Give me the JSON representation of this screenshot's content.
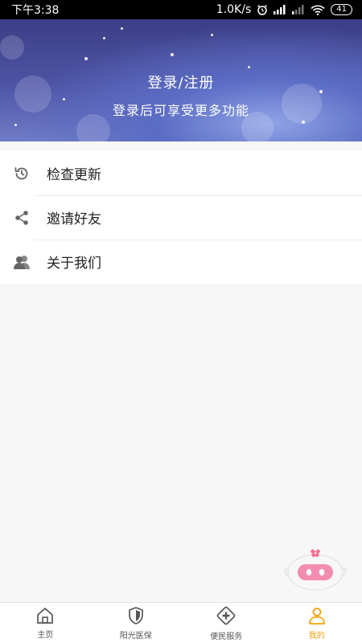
{
  "status_bar": {
    "time": "下午3:38",
    "network_speed": "1.0K/s",
    "battery": "41",
    "icons": [
      "alarm-icon",
      "signal-icon",
      "signal-weak-icon",
      "wifi-icon",
      "battery-icon"
    ]
  },
  "banner": {
    "title": "登录/注册",
    "subtitle": "登录后可享受更多功能"
  },
  "menu": {
    "items": [
      {
        "label": "检查更新",
        "icon": "refresh-clock-icon"
      },
      {
        "label": "邀请好友",
        "icon": "share-icon"
      },
      {
        "label": "关于我们",
        "icon": "users-icon"
      }
    ]
  },
  "tabbar": {
    "active_color": "#f4a10b",
    "inactive_color": "#555555",
    "items": [
      {
        "label": "主页",
        "icon": "home-icon",
        "active": false
      },
      {
        "label": "阳光医保",
        "icon": "shield-icon",
        "active": false
      },
      {
        "label": "便民服务",
        "icon": "medical-cross-icon",
        "active": false
      },
      {
        "label": "我的",
        "icon": "person-icon",
        "active": true
      }
    ]
  }
}
